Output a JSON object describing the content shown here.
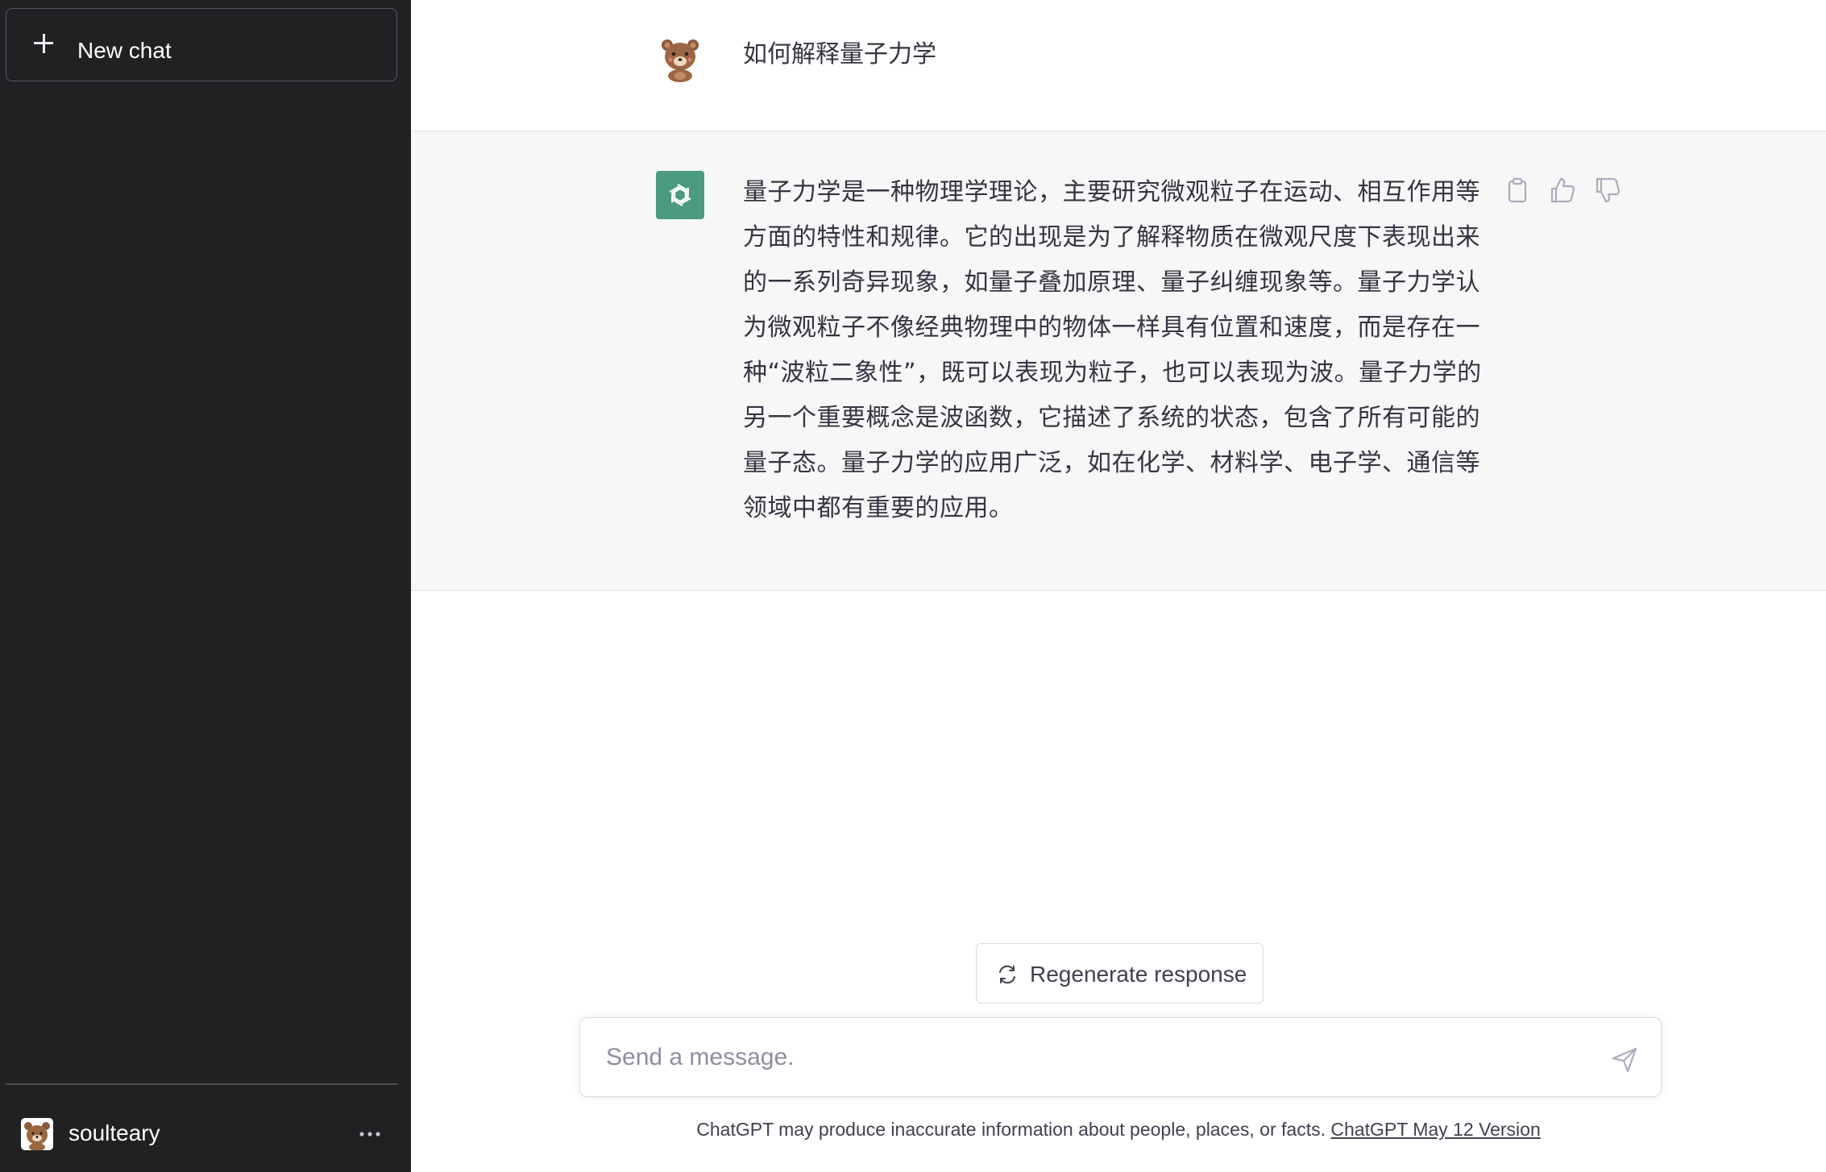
{
  "sidebar": {
    "new_chat_label": "New chat",
    "user": {
      "name": "soulteary"
    }
  },
  "conversation": {
    "user_message": "如何解释量子力学",
    "assistant_message": "量子力学是一种物理学理论，主要研究微观粒子在运动、相互作用等方面的特性和规律。它的出现是为了解释物质在微观尺度下表现出来的一系列奇异现象，如量子叠加原理、量子纠缠现象等。量子力学认为微观粒子不像经典物理中的物体一样具有位置和速度，而是存在一种“波粒二象性”，既可以表现为粒子，也可以表现为波。量子力学的另一个重要概念是波函数，它描述了系统的状态，包含了所有可能的量子态。量子力学的应用广泛，如在化学、材料学、电子学、通信等领域中都有重要的应用。",
    "actions": [
      "copy-icon",
      "thumbs-up-icon",
      "thumbs-down-icon"
    ]
  },
  "composer": {
    "regenerate_label": "Regenerate response",
    "placeholder": "Send a message."
  },
  "footer": {
    "disclaimer": "ChatGPT may produce inaccurate information about people, places, or facts. ",
    "version_link": "ChatGPT May 12 Version"
  },
  "colors": {
    "sidebar_bg": "#202123",
    "assistant_bg": "#f7f7f8",
    "gpt_avatar": "#4a9b7f",
    "text": "#343541"
  }
}
